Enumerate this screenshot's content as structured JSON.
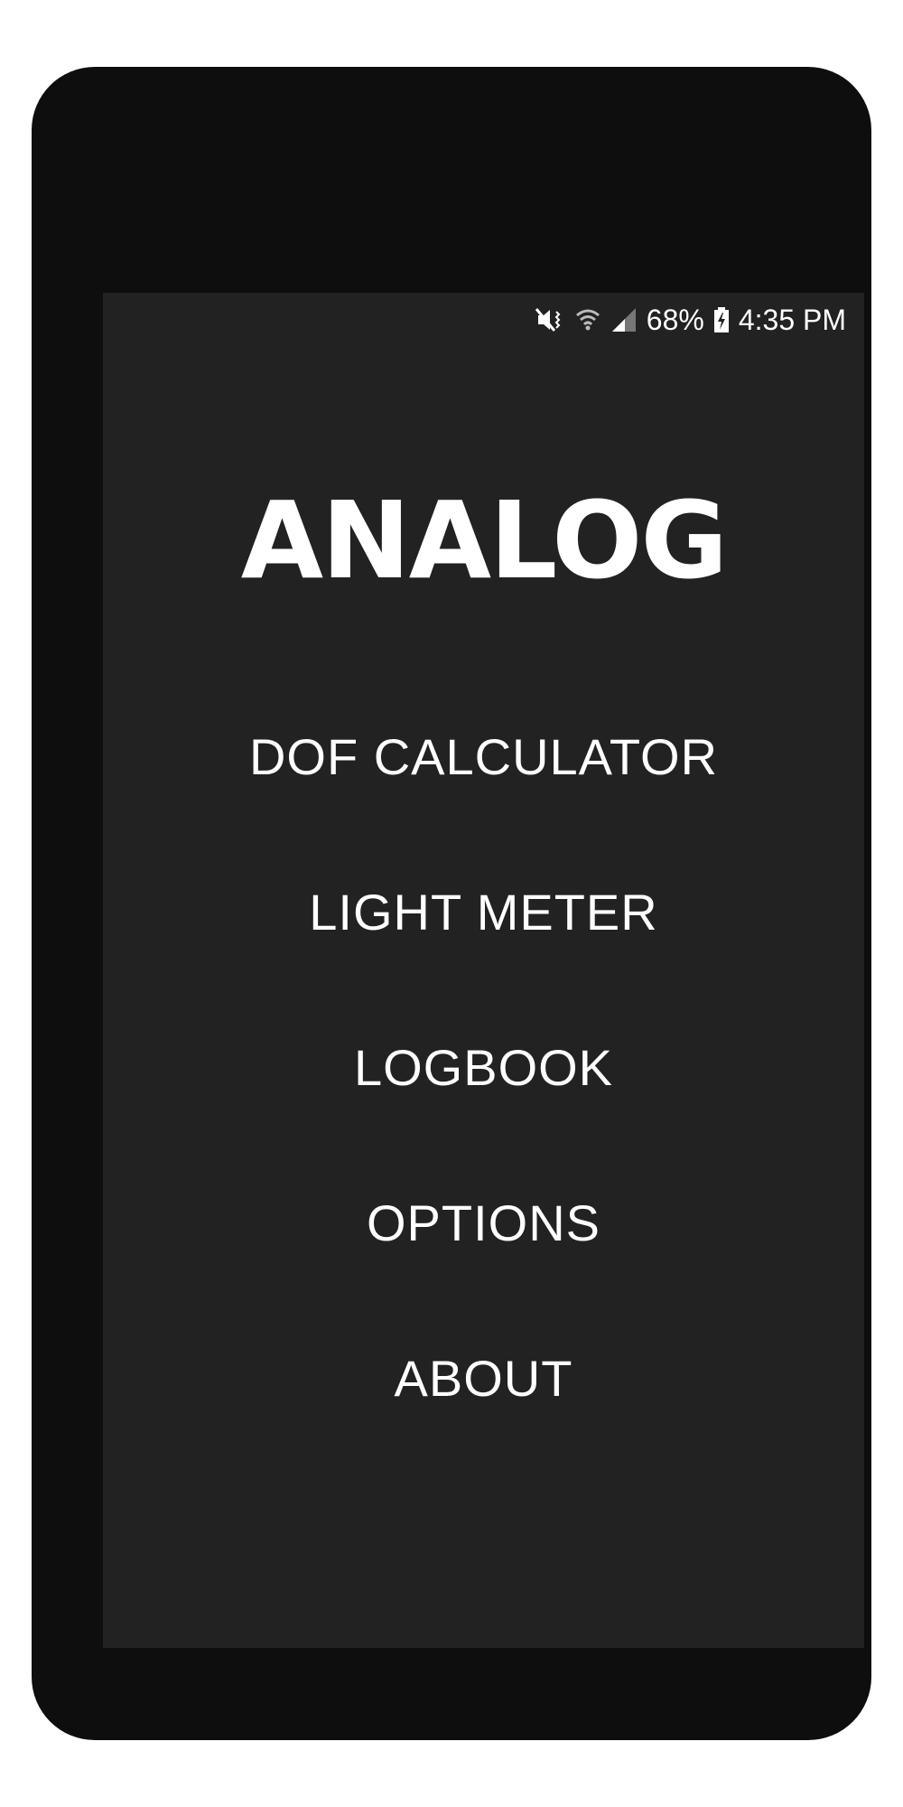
{
  "status_bar": {
    "battery_percent": "68%",
    "time": "4:35 PM",
    "icons": [
      "mute-vibrate-icon",
      "wifi-icon",
      "cell-signal-icon",
      "battery-charging-icon"
    ]
  },
  "app": {
    "title": "ANALOG"
  },
  "menu": {
    "items": [
      {
        "label": "DOF CALCULATOR"
      },
      {
        "label": "LIGHT METER"
      },
      {
        "label": "LOGBOOK"
      },
      {
        "label": "OPTIONS"
      },
      {
        "label": "ABOUT"
      }
    ]
  },
  "colors": {
    "bezel": "#0e0e0e",
    "screen_background": "#222222",
    "text": "#ffffff"
  }
}
